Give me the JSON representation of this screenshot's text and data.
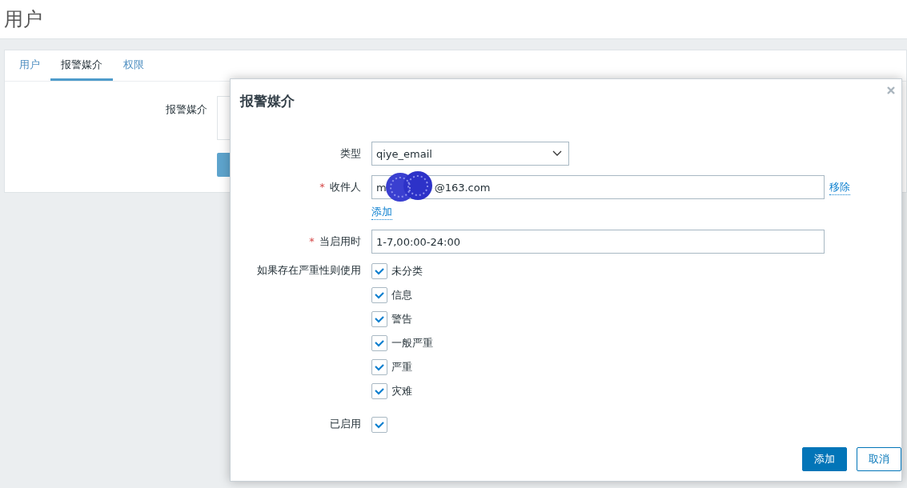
{
  "page_title": "用户",
  "tabs": [
    {
      "label": "用户",
      "selected": false
    },
    {
      "label": "报警媒介",
      "selected": true
    },
    {
      "label": "权限",
      "selected": false
    }
  ],
  "background_form": {
    "label": "报警媒介"
  },
  "dialog": {
    "title": "报警媒介",
    "type": {
      "label": "类型",
      "value": "qiye_email"
    },
    "recipient": {
      "label": "收件人",
      "required_mark": "*",
      "value_start": "m",
      "value_end": "@163.com",
      "remove_link": "移除",
      "add_link": "添加"
    },
    "when_active": {
      "label": "当启用时",
      "required_mark": "*",
      "value": "1-7,00:00-24:00"
    },
    "severity": {
      "label": "如果存在严重性则使用",
      "options": [
        {
          "label": "未分类",
          "checked": true
        },
        {
          "label": "信息",
          "checked": true
        },
        {
          "label": "警告",
          "checked": true
        },
        {
          "label": "一般严重",
          "checked": true
        },
        {
          "label": "严重",
          "checked": true
        },
        {
          "label": "灾难",
          "checked": true
        }
      ]
    },
    "enabled": {
      "label": "已启用",
      "checked": true
    },
    "buttons": [
      {
        "label": "添加",
        "kind": "primary"
      },
      {
        "label": "取消",
        "kind": "secondary"
      }
    ]
  }
}
